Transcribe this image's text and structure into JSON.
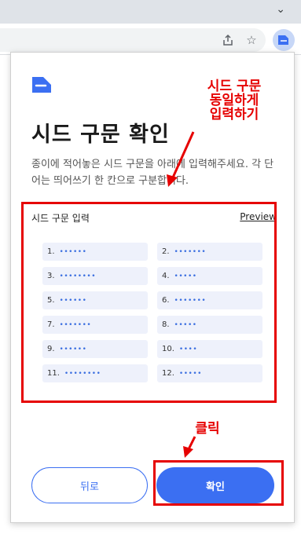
{
  "popup": {
    "title": "시드 구문 확인",
    "description": "종이에 적어놓은 시드 구문을 아래에 입력해주세요. 각 단어는 띄어쓰기 한 칸으로 구분합니다.",
    "seed_section": {
      "label": "시드 구문 입력",
      "preview_label": "Preview",
      "words": [
        {
          "num": "1.",
          "masked": "••••••"
        },
        {
          "num": "2.",
          "masked": "•••••••"
        },
        {
          "num": "3.",
          "masked": "••••••••"
        },
        {
          "num": "4.",
          "masked": "•••••"
        },
        {
          "num": "5.",
          "masked": "••••••"
        },
        {
          "num": "6.",
          "masked": "•••••••"
        },
        {
          "num": "7.",
          "masked": "•••••••"
        },
        {
          "num": "8.",
          "masked": "•••••"
        },
        {
          "num": "9.",
          "masked": "••••••"
        },
        {
          "num": "10.",
          "masked": "••••"
        },
        {
          "num": "11.",
          "masked": "••••••••"
        },
        {
          "num": "12.",
          "masked": "•••••"
        }
      ]
    },
    "back_button": "뒤로",
    "confirm_button": "확인"
  },
  "annotations": {
    "seed_note_lines": [
      "시드 구문",
      "동일하게",
      "입력하기"
    ],
    "click_note": "클릭"
  },
  "colors": {
    "accent": "#3b6ff2",
    "annotation": "#e60000",
    "word_bg": "#eef1fb"
  },
  "icons": {
    "toolbar": [
      "share-icon",
      "star-icon",
      "extension-icon"
    ],
    "tabstrip": "chevron-down-icon",
    "logo": "wallet-logo-icon"
  }
}
